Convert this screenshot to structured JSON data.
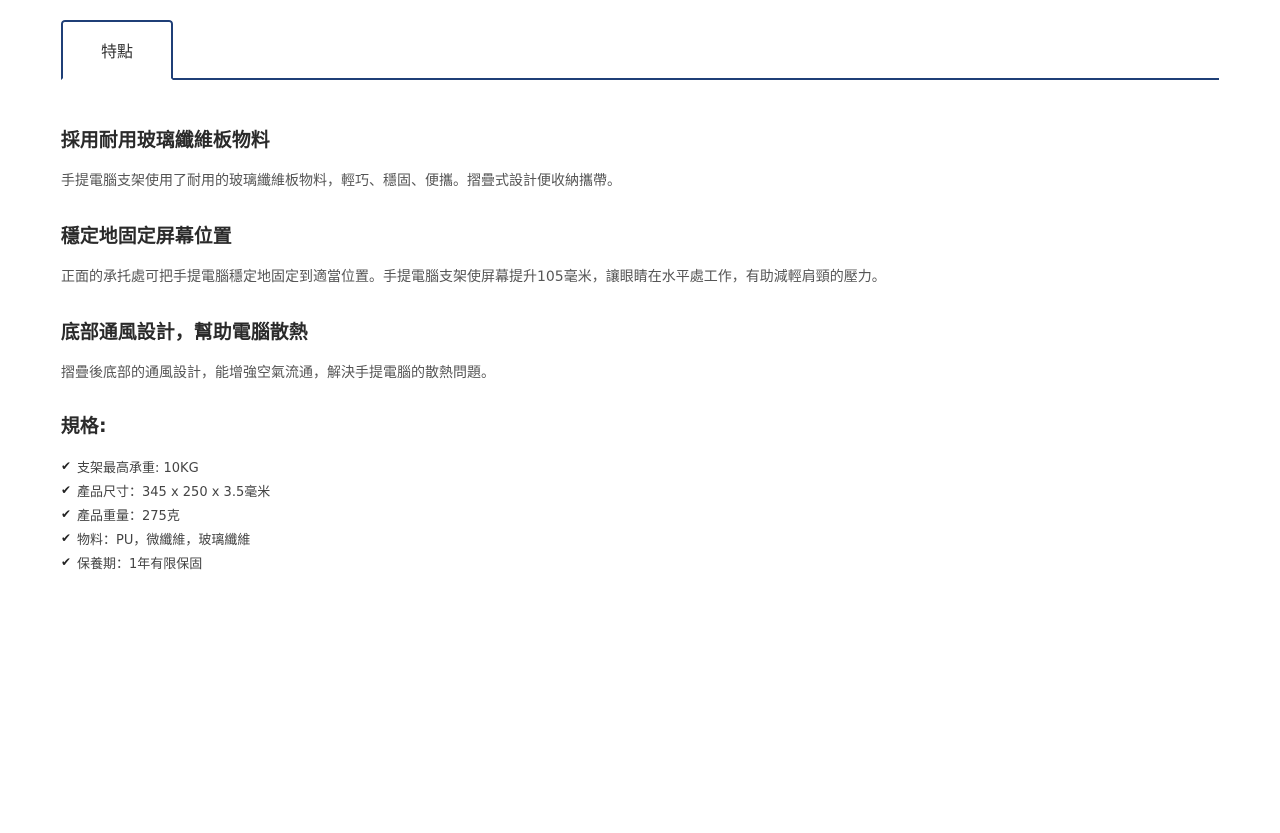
{
  "tabs": [
    {
      "label": "特點"
    }
  ],
  "sections": [
    {
      "title": "採用耐用玻璃纖維板物料",
      "text": "手提電腦支架使用了耐用的玻璃纖維板物料，輕巧、穩固、便攜。摺疊式設計便收納攜帶。"
    },
    {
      "title": "穩定地固定屏幕位置",
      "text": "正面的承托處可把手提電腦穩定地固定到適當位置。手提電腦支架使屏幕提升105毫米，讓眼睛在水平處工作，有助減輕肩頸的壓力。"
    },
    {
      "title": "底部通風設計，幫助電腦散熱",
      "text": "摺疊後底部的通風設計，能增強空氣流通，解決手提電腦的散熱問題。"
    }
  ],
  "specs": {
    "title": "規格:",
    "check_icon": "✔",
    "items": [
      "支架最高承重: 10KG",
      "產品尺寸：345 x 250 x 3.5毫米",
      "產品重量：275克",
      "物料：PU，微纖維，玻璃纖維",
      "保養期：1年有限保固"
    ]
  }
}
